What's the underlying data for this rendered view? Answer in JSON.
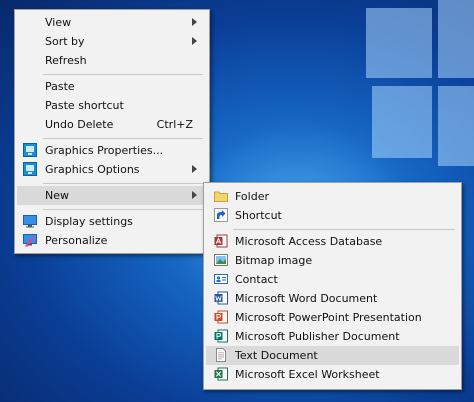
{
  "context_menu": {
    "view": "View",
    "sort_by": "Sort by",
    "refresh": "Refresh",
    "paste": "Paste",
    "paste_shortcut": "Paste shortcut",
    "undo_delete": "Undo Delete",
    "undo_delete_shortcut": "Ctrl+Z",
    "graphics_properties": "Graphics Properties...",
    "graphics_options": "Graphics Options",
    "new": "New",
    "display_settings": "Display settings",
    "personalize": "Personalize"
  },
  "new_submenu": {
    "folder": "Folder",
    "shortcut": "Shortcut",
    "access": "Microsoft Access Database",
    "bitmap": "Bitmap image",
    "contact": "Contact",
    "word": "Microsoft Word Document",
    "powerpoint": "Microsoft PowerPoint Presentation",
    "publisher": "Microsoft Publisher Document",
    "text": "Text Document",
    "excel": "Microsoft Excel Worksheet"
  },
  "icons": {
    "graphics_properties": "intel-graphics-icon",
    "graphics_options": "intel-graphics-icon",
    "display_settings": "monitor-icon",
    "personalize": "personalize-icon",
    "folder": "folder-icon",
    "shortcut": "shortcut-arrow-icon",
    "access": "access-icon",
    "bitmap": "bitmap-icon",
    "contact": "contact-card-icon",
    "word": "word-icon",
    "powerpoint": "powerpoint-icon",
    "publisher": "publisher-icon",
    "text": "text-document-icon",
    "excel": "excel-icon"
  },
  "colors": {
    "menu_bg": "#f2f2f2",
    "highlight": "#dadada",
    "desktop_blue": "#1462bf",
    "word_blue": "#2b579a",
    "excel_green": "#217346",
    "powerpoint_red": "#d24726",
    "access_red": "#a4373a",
    "publisher_teal": "#077568",
    "folder_yellow": "#f5d46b"
  }
}
